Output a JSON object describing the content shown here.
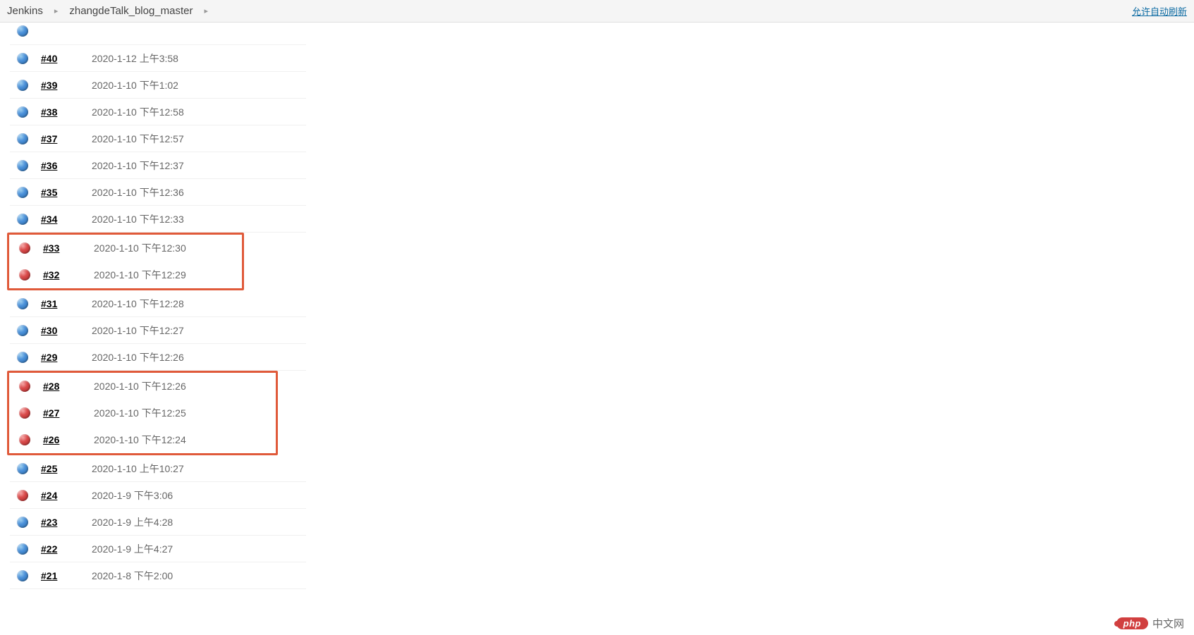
{
  "breadcrumb": {
    "root": "Jenkins",
    "project": "zhangdeTalk_blog_master"
  },
  "header": {
    "auto_refresh": "允许自动刷新"
  },
  "builds": [
    {
      "num": "#40",
      "time": "2020-1-12 上午3:58",
      "status": "blue"
    },
    {
      "num": "#39",
      "time": "2020-1-10 下午1:02",
      "status": "blue"
    },
    {
      "num": "#38",
      "time": "2020-1-10 下午12:58",
      "status": "blue"
    },
    {
      "num": "#37",
      "time": "2020-1-10 下午12:57",
      "status": "blue"
    },
    {
      "num": "#36",
      "time": "2020-1-10 下午12:37",
      "status": "blue"
    },
    {
      "num": "#35",
      "time": "2020-1-10 下午12:36",
      "status": "blue"
    },
    {
      "num": "#34",
      "time": "2020-1-10 下午12:33",
      "status": "blue"
    },
    {
      "num": "#33",
      "time": "2020-1-10 下午12:30",
      "status": "red"
    },
    {
      "num": "#32",
      "time": "2020-1-10 下午12:29",
      "status": "red"
    },
    {
      "num": "#31",
      "time": "2020-1-10 下午12:28",
      "status": "blue"
    },
    {
      "num": "#30",
      "time": "2020-1-10 下午12:27",
      "status": "blue"
    },
    {
      "num": "#29",
      "time": "2020-1-10 下午12:26",
      "status": "blue"
    },
    {
      "num": "#28",
      "time": "2020-1-10 下午12:26",
      "status": "red"
    },
    {
      "num": "#27",
      "time": "2020-1-10 下午12:25",
      "status": "red"
    },
    {
      "num": "#26",
      "time": "2020-1-10 下午12:24",
      "status": "red"
    },
    {
      "num": "#25",
      "time": "2020-1-10 上午10:27",
      "status": "blue"
    },
    {
      "num": "#24",
      "time": "2020-1-9 下午3:06",
      "status": "red"
    },
    {
      "num": "#23",
      "time": "2020-1-9 上午4:28",
      "status": "blue"
    },
    {
      "num": "#22",
      "time": "2020-1-9 上午4:27",
      "status": "blue"
    },
    {
      "num": "#21",
      "time": "2020-1-8 下午2:00",
      "status": "blue"
    }
  ],
  "watermark": {
    "badge": "php",
    "text": "中文网"
  }
}
